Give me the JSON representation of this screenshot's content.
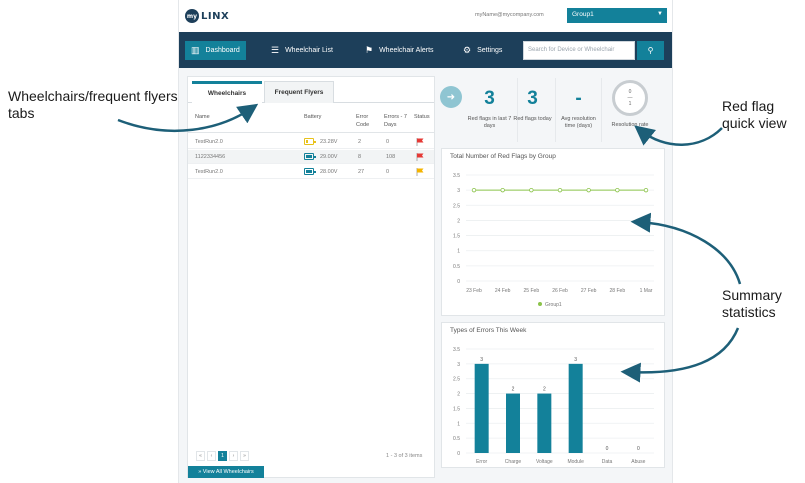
{
  "header": {
    "logo_text": "LINX",
    "user_email": "myName@mycompany.com",
    "group_select": "Group1"
  },
  "nav": {
    "items": [
      {
        "label": "Dashboard",
        "icon": "bar-chart-icon"
      },
      {
        "label": "Wheelchair List",
        "icon": "list-icon"
      },
      {
        "label": "Wheelchair Alerts",
        "icon": "flag-icon"
      },
      {
        "label": "Settings",
        "icon": "gear-icon"
      }
    ],
    "search_placeholder": "Search for Device or Wheelchair"
  },
  "tabs": [
    "Wheelchairs",
    "Frequent Flyers"
  ],
  "table": {
    "columns": [
      "Name",
      "Battery",
      "Error Code",
      "Errors - 7 Days",
      "Status"
    ],
    "rows": [
      {
        "name": "TestRun2.0",
        "battery": "23.28V",
        "battery_level": 0.3,
        "battery_color": "#e8c21b",
        "error_code": "2",
        "errors_7d": "0",
        "flag_color": "#e53935"
      },
      {
        "name": "1122334456",
        "battery": "29.00V",
        "battery_level": 0.8,
        "battery_color": "#13819a",
        "error_code": "8",
        "errors_7d": "108",
        "flag_color": "#e53935"
      },
      {
        "name": "TestRun2.0",
        "battery": "28.00V",
        "battery_level": 0.8,
        "battery_color": "#13819a",
        "error_code": "27",
        "errors_7d": "0",
        "flag_color": "#f4b400"
      }
    ]
  },
  "pager": {
    "info": "1 - 3 of 3 items",
    "current": "1"
  },
  "view_all": "» View All Wheelchairs",
  "stats": [
    {
      "value": "3",
      "label": "Red flags in last 7 days"
    },
    {
      "value": "3",
      "label": "Red flags today"
    },
    {
      "value": "-",
      "label": "Avg resolution time (days)"
    }
  ],
  "resolution": {
    "top": "0",
    "bottom": "1",
    "label": "Resolution rate"
  },
  "callouts": {
    "tabs": "Wheelchairs/frequent flyers tabs",
    "red_flag": "Red flag quick view",
    "summary": "Summary statistics"
  },
  "colors": {
    "accent": "#13819a",
    "nav": "#1d3f5a",
    "line": "#8bc34a"
  },
  "chart_data": [
    {
      "type": "line",
      "title": "Total Number of Red Flags by Group",
      "categories": [
        "23 Feb",
        "24 Feb",
        "25 Feb",
        "26 Feb",
        "27 Feb",
        "28 Feb",
        "1 Mar"
      ],
      "series": [
        {
          "name": "Group1",
          "values": [
            3,
            3,
            3,
            3,
            3,
            3,
            3
          ]
        }
      ],
      "ylim": [
        0,
        3.5
      ],
      "yticks": [
        "0",
        "0.5",
        "1",
        "1.5",
        "2",
        "2.5",
        "3",
        "3.5"
      ],
      "legend": "bottom",
      "grid": true
    },
    {
      "type": "bar",
      "title": "Types of Errors This Week",
      "categories": [
        "Error",
        "Charge",
        "Voltage",
        "Module",
        "Data",
        "Abuse"
      ],
      "values": [
        3,
        2,
        2,
        3,
        0,
        0
      ],
      "ylim": [
        0,
        3.5
      ],
      "yticks": [
        "0",
        "0.5",
        "1",
        "1.5",
        "2",
        "2.5",
        "3",
        "3.5"
      ],
      "grid": true
    }
  ]
}
